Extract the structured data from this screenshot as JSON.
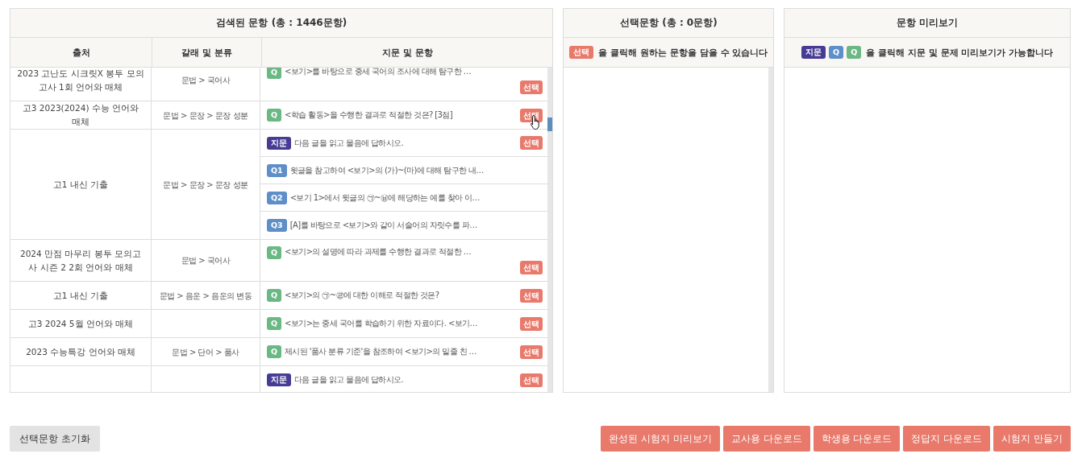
{
  "search_panel": {
    "title": "검색된 문항 (총 : 1446문항)",
    "columns": [
      "출처",
      "갈래 및 분류",
      "지문 및 문항"
    ],
    "rows": [
      {
        "source": "2023 고난도 시크릿X 봉투 모의고사 1회 언어와 매체",
        "category": "문법 > 국어사",
        "items": [
          {
            "kind": "q",
            "badge": "Q",
            "text": "<보기>를 바탕으로 중세 국어의 조사에 대해 탐구한 …",
            "button": "선택",
            "tall": true
          }
        ]
      },
      {
        "source": "고3 2023(2024) 수능 언어와 매체",
        "category": "문법 > 문장 > 문장 성분",
        "items": [
          {
            "kind": "q",
            "badge": "Q",
            "text": "<학습 활동>을 수행한 결과로 적절한 것은? [3점]",
            "button": "선택",
            "hovered": true
          }
        ]
      },
      {
        "source": "고1 내신 기출",
        "category": "문법 > 문장 > 문장 성분",
        "items": [
          {
            "kind": "passage",
            "badge": "지문",
            "text": "다음 글을 읽고 물음에 답하시오.",
            "button": "선택"
          },
          {
            "kind": "sub",
            "badge": "Q1",
            "text": "윗글을 참고하여 <보기>의 (가)~(마)에 대해 탐구한 내…"
          },
          {
            "kind": "sub",
            "badge": "Q2",
            "text": "<보기 1>에서 윗글의 ㉠~㉥에 해당하는 예를 찾아 이…"
          },
          {
            "kind": "sub",
            "badge": "Q3",
            "text": "[A]를 바탕으로 <보기>와 같이 서술어의 자릿수를 파…"
          }
        ]
      },
      {
        "source": "2024 만점 마무리 봉투 모의고사 시즌 2 2회 언어와 매체",
        "category": "문법 > 국어사",
        "items": [
          {
            "kind": "q",
            "badge": "Q",
            "text": "<보기>의 설명에 따라 과제를 수행한 결과로 적절한 …",
            "button": "선택",
            "tall": true
          }
        ]
      },
      {
        "source": "고1 내신 기출",
        "category": "문법 > 음운 > 음운의 변동",
        "items": [
          {
            "kind": "q",
            "badge": "Q",
            "text": "<보기>의 ㉠~㉣에 대한 이해로 적절한 것은?",
            "button": "선택"
          }
        ]
      },
      {
        "source": "고3 2024 5월 언어와 매체",
        "items": [
          {
            "kind": "q",
            "badge": "Q",
            "text": "<보기>는 중세 국어를 학습하기 위한 자료이다. <보기…",
            "button": "선택"
          }
        ]
      },
      {
        "source": "2023 수능특강 언어와 매체",
        "category": "문법 > 단어 > 품사",
        "items": [
          {
            "kind": "q",
            "badge": "Q",
            "text": "제시된 '품사 분류 기준'을 참조하여 <보기>의 밑줄 친 …",
            "button": "선택"
          }
        ]
      },
      {
        "items": [
          {
            "kind": "passage",
            "badge": "지문",
            "text": "다음 글을 읽고 물음에 답하시오.",
            "button": "선택"
          }
        ]
      }
    ]
  },
  "selected_panel": {
    "title": "선택문항 (총 : 0문항)",
    "hint_badge": "선택",
    "hint": "을 클릭해 원하는 문항을 담을 수 있습니다"
  },
  "preview_panel": {
    "title": "문항 미리보기",
    "hint_badges": [
      {
        "kind": "passage",
        "text": "지문"
      },
      {
        "kind": "sub",
        "text": "Q"
      },
      {
        "kind": "q",
        "text": "Q"
      }
    ],
    "hint": "을 클릭해 지문 및 문제 미리보기가 가능합니다"
  },
  "reset_button": "선택문항 초기화",
  "action_buttons": [
    "완성된 시험지 미리보기",
    "교사용 다운로드",
    "학생용 다운로드",
    "정답지 다운로드",
    "시험지 만들기"
  ]
}
